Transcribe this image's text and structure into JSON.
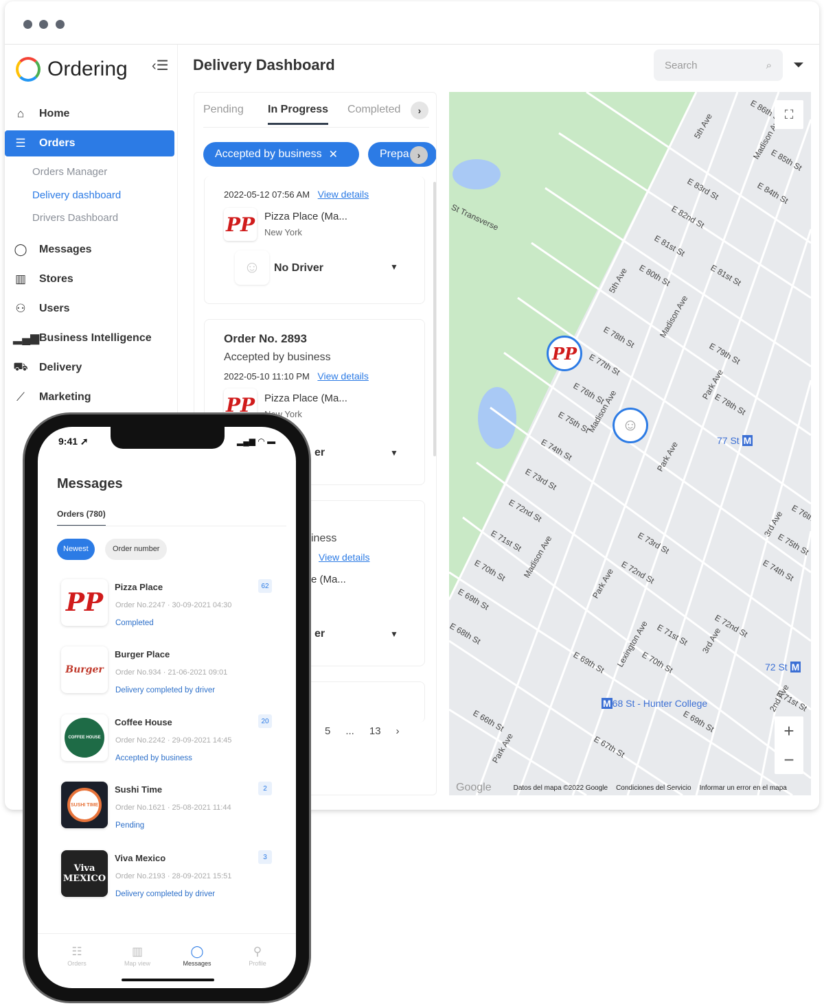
{
  "app": {
    "name": "Ordering",
    "title": "Delivery Dashboard",
    "search_placeholder": "Search"
  },
  "sidebar": {
    "items": [
      {
        "label": "Home",
        "icon": "home-icon"
      },
      {
        "label": "Orders",
        "icon": "list-icon"
      },
      {
        "label": "Messages",
        "icon": "chat-icon"
      },
      {
        "label": "Stores",
        "icon": "store-icon"
      },
      {
        "label": "Users",
        "icon": "users-icon"
      },
      {
        "label": "Business Intelligence",
        "icon": "bar-chart-icon"
      },
      {
        "label": "Delivery",
        "icon": "truck-icon"
      },
      {
        "label": "Marketing",
        "icon": "line-chart-icon"
      }
    ],
    "sub_items": [
      {
        "label": "Orders Manager"
      },
      {
        "label": "Delivery dashboard"
      },
      {
        "label": "Drivers Dashboard"
      }
    ]
  },
  "tabs": [
    {
      "label": "Pending"
    },
    {
      "label": "In Progress"
    },
    {
      "label": "Completed"
    }
  ],
  "chips": [
    {
      "label": "Accepted by business"
    },
    {
      "label": "Prepa"
    }
  ],
  "orders": [
    {
      "date": "2022-05-12 07:56 AM",
      "link": "View details",
      "business": "Pizza Place (Ma...",
      "city": "New York",
      "driver": "No Driver"
    },
    {
      "number": "Order No. 2893",
      "status": "Accepted by business",
      "date": "2022-05-10 11:10 PM",
      "link": "View details",
      "business": "Pizza Place (Ma...",
      "city": "New York",
      "driver_partial": "er"
    },
    {
      "status_partial": "iness",
      "link": "View details",
      "business_partial": "e (Ma...",
      "driver_partial": "er"
    }
  ],
  "pagination": {
    "pages": [
      "5",
      "...",
      "13"
    ]
  },
  "map": {
    "labels": [
      "St Transverse",
      "5th Ave",
      "E 86th St",
      "Madison Ave",
      "E 85th St",
      "E 84th St",
      "E 83rd St",
      "E 82nd St",
      "E 81st St",
      "E 80th St",
      "E 81st St",
      "5th Ave",
      "Madison Ave",
      "E 79th St",
      "E 78th St",
      "E 77th St",
      "E 76th St",
      "E 75th St",
      "E 74th St",
      "E 73rd St",
      "E 72nd St",
      "E 71st St",
      "E 70th St",
      "E 69th St",
      "Park Ave",
      "Madison Ave",
      "Park Ave",
      "E 73rd St",
      "E 72nd St",
      "E 71st St",
      "E 70th St",
      "E 69th St",
      "E 68th St",
      "E 67th St",
      "E 66th St",
      "Lexington Ave",
      "3rd Ave",
      "E 72nd St",
      "2nd Ave",
      "E 71st St",
      "E 74th St",
      "E 75th St",
      "3rd Ave",
      "E 76th",
      "E 78th St",
      "Park Ave",
      "E 69th St",
      "Madison Ave",
      "Park Ave"
    ],
    "transit": [
      "77 St",
      "72 St",
      "68 St - Hunter College"
    ],
    "attribution": [
      "Google",
      "Datos del mapa ©2022 Google",
      "Condiciones del Servicio",
      "Informar un error en el mapa"
    ]
  },
  "phone": {
    "time": "9:41",
    "title": "Messages",
    "tab": "Orders (780)",
    "sort": [
      "Newest",
      "Order number"
    ],
    "messages": [
      {
        "name": "Pizza Place",
        "meta": "Order No.2247 · 30-09-2021 04:30",
        "status": "Completed",
        "count": "62",
        "logo": "PP"
      },
      {
        "name": "Burger Place",
        "meta": "Order No.934 · 21-06-2021 09:01",
        "status": "Delivery completed by driver",
        "logo": "Burger"
      },
      {
        "name": "Coffee House",
        "meta": "Order No.2242 · 29-09-2021 14:45",
        "status": "Accepted by business",
        "count": "20",
        "logo": "COFFEE HOUSE"
      },
      {
        "name": "Sushi Time",
        "meta": "Order No.1621 · 25-08-2021 11:44",
        "status": "Pending",
        "count": "2",
        "logo": "SUSHI TIME"
      },
      {
        "name": "Viva Mexico",
        "meta": "Order No.2193 · 28-09-2021 15:51",
        "status": "Delivery completed by driver",
        "count": "3",
        "logo": "Viva MEXICO"
      }
    ],
    "bottom_tabs": [
      {
        "label": "Orders"
      },
      {
        "label": "Map view"
      },
      {
        "label": "Messages"
      },
      {
        "label": "Profile"
      }
    ]
  },
  "colors": {
    "primary": "#2c7be5",
    "park": "#c9e9c6",
    "water": "#a9c9f5"
  }
}
